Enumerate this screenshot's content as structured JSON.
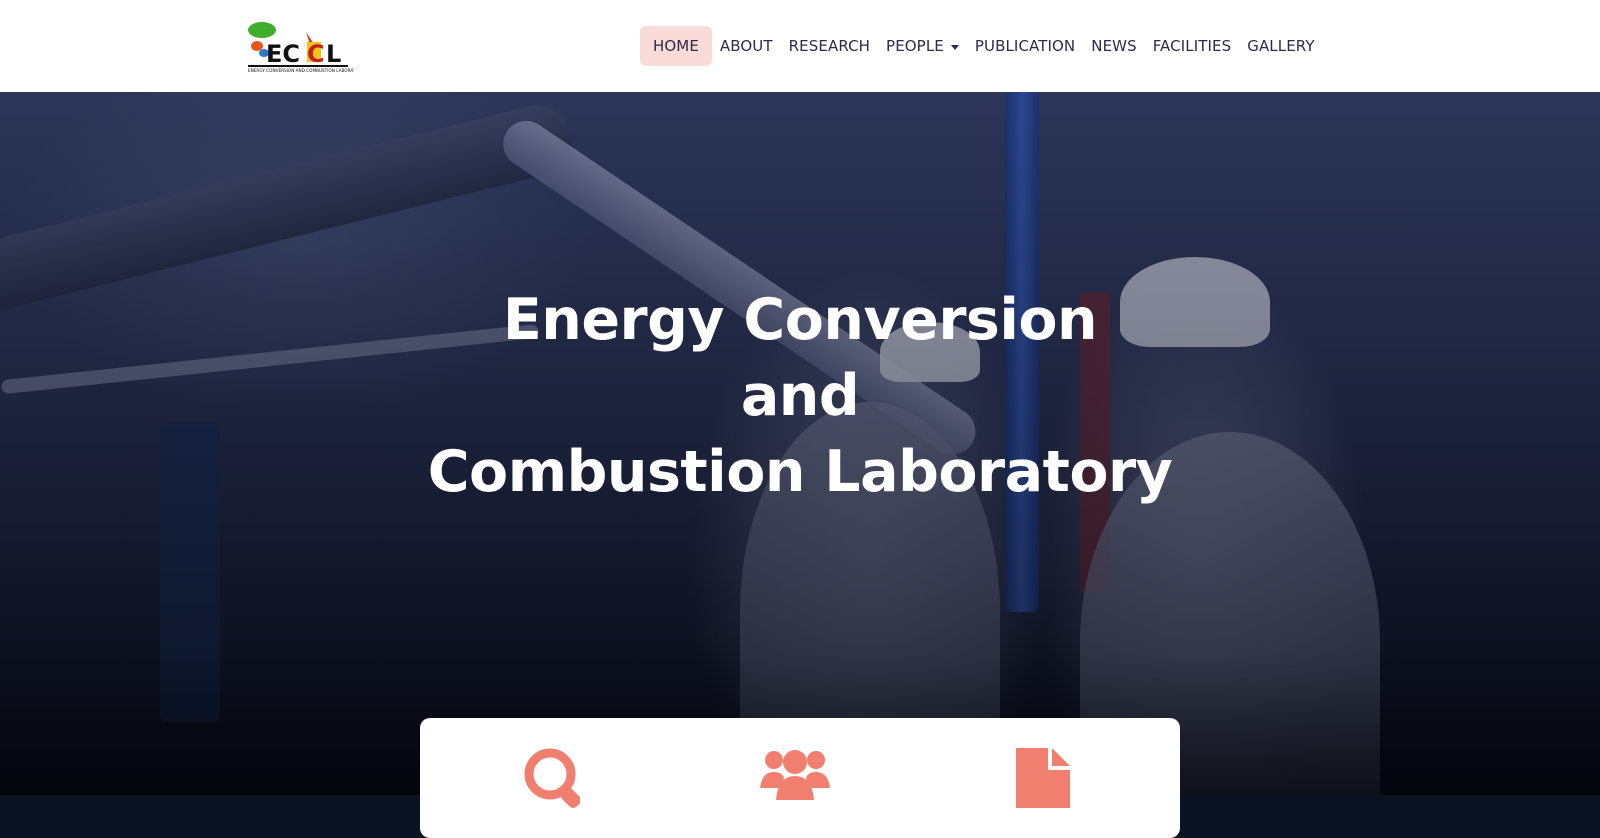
{
  "brand": {
    "logo_text": "ECCL",
    "logo_subtext": "ENERGY CONVERSION AND COMBUSTION LABORATORY"
  },
  "nav": {
    "items": [
      {
        "label": "HOME",
        "active": true
      },
      {
        "label": "ABOUT"
      },
      {
        "label": "RESEARCH"
      },
      {
        "label": "PEOPLE",
        "has_dropdown": true
      },
      {
        "label": "PUBLICATION"
      },
      {
        "label": "NEWS"
      },
      {
        "label": "FACILITIES"
      },
      {
        "label": "GALLERY"
      }
    ]
  },
  "hero": {
    "title_lines": [
      "Energy Conversion",
      "and",
      "Combustion Laboratory"
    ]
  },
  "features": {
    "icons": [
      "search-icon",
      "people-icon",
      "document-icon"
    ],
    "accent": "#f07f70"
  },
  "colors": {
    "nav_active_bg": "#f9dcd8",
    "nav_text": "#2d2a4a",
    "accent": "#f07f70"
  }
}
